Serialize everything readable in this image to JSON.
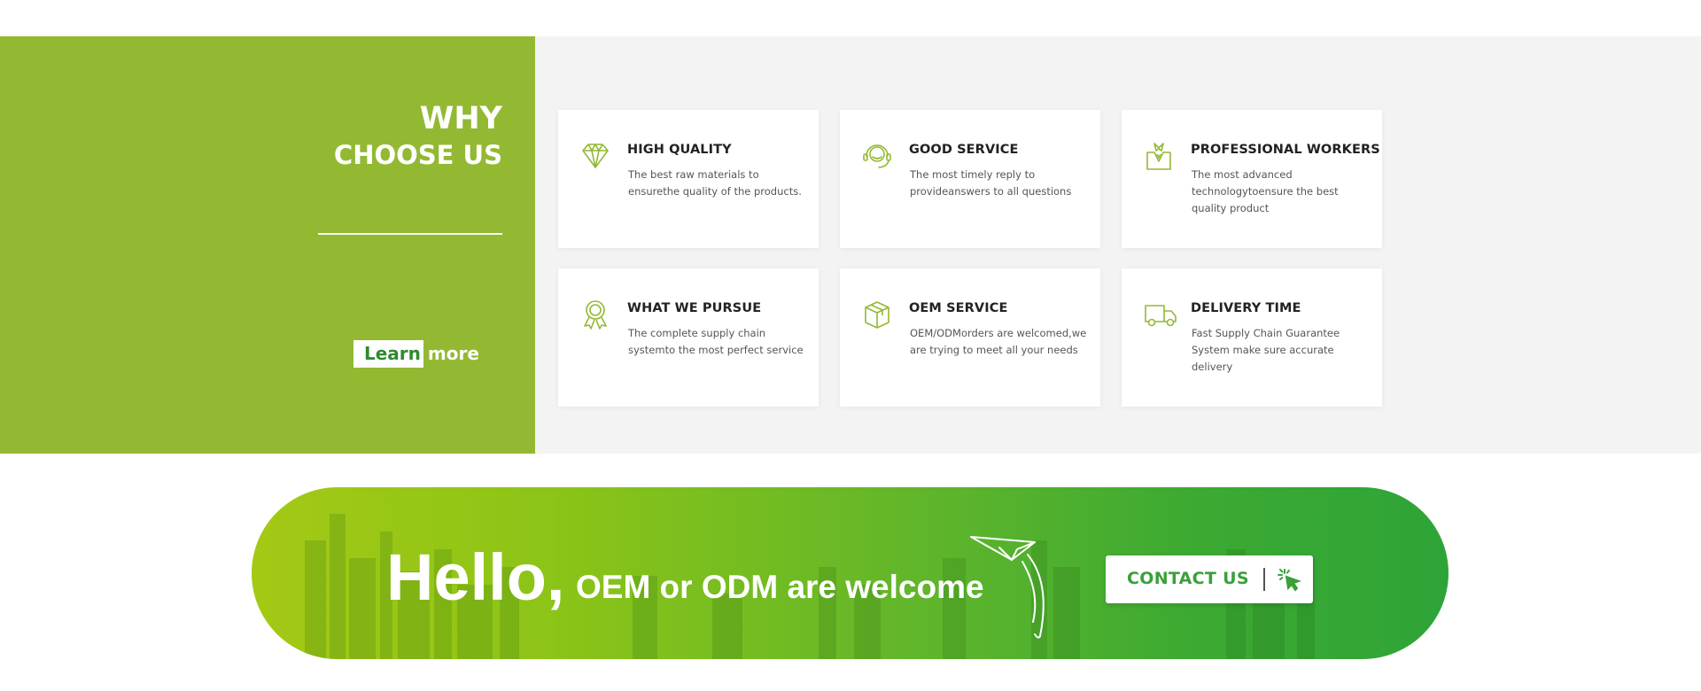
{
  "why": {
    "title_line1": "WHY",
    "title_line2": "CHOOSE US",
    "learn_label": "Learn",
    "more_label": "more",
    "accent": "#93b933"
  },
  "cards": [
    {
      "icon": "diamond-icon",
      "title": "HIGH QUALITY",
      "desc": "The best raw materials to ensurethe quality of the products."
    },
    {
      "icon": "headset-icon",
      "title": "GOOD SERVICE",
      "desc": "The most timely reply to provideanswers to all questions"
    },
    {
      "icon": "worker-icon",
      "title": "PROFESSIONAL WORKERS",
      "desc": "The most advanced technologytoensure the best quality product"
    },
    {
      "icon": "medal-icon",
      "title": "WHAT WE PURSUE",
      "desc": "The complete supply chain systemto the most perfect service"
    },
    {
      "icon": "box-icon",
      "title": "OEM SERVICE",
      "desc": "OEM/ODMorders are welcomed,we are trying to meet all your needs"
    },
    {
      "icon": "truck-icon",
      "title": "DELIVERY TIME",
      "desc": "Fast Supply Chain Guarantee System make sure accurate delivery"
    }
  ],
  "banner": {
    "hello": "Hello,",
    "tagline": "OEM or ODM are welcome",
    "contact_label": "CONTACT US",
    "gradient_start": "#a4c915",
    "gradient_end": "#2ea437"
  }
}
